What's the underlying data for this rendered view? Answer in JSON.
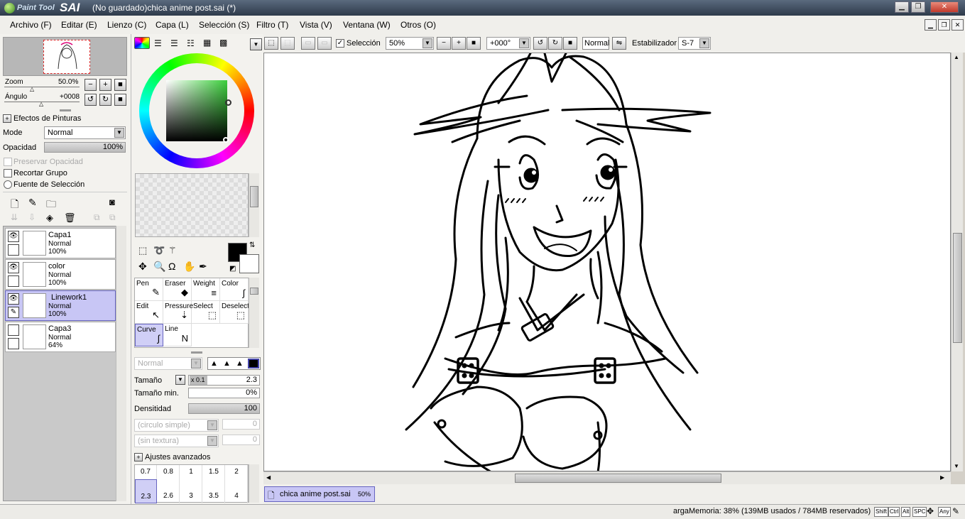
{
  "window": {
    "logo_small": "Paint Tool",
    "logo_big": "SAI",
    "title": "(No guardado)chica anime post.sai (*)"
  },
  "menu": [
    "Archivo (F)",
    "Editar (E)",
    "Lienzo (C)",
    "Capa (L)",
    "Selección (S)",
    "Filtro (T)",
    "Vista (V)",
    "Ventana (W)",
    "Otros (O)"
  ],
  "navigator": {
    "zoom_label": "Zoom",
    "zoom_value": "50.0%",
    "angle_label": "Ángulo",
    "angle_value": "+0008"
  },
  "effects": {
    "header": "Efectos de Pinturas",
    "mode_label": "Mode",
    "mode_value": "Normal",
    "opacity_label": "Opacidad",
    "opacity_value": "100%",
    "preserve_opacity": "Preservar Opacidad",
    "clip_group": "Recortar Grupo",
    "selection_source": "Fuente de Selección"
  },
  "layers": [
    {
      "name": "Capa1",
      "mode": "Normal",
      "opacity": "100%",
      "visible": true,
      "selected": false
    },
    {
      "name": "color",
      "mode": "Normal",
      "opacity": "100%",
      "visible": true,
      "selected": false
    },
    {
      "name": "Linework1",
      "mode": "Normal",
      "opacity": "100%",
      "visible": true,
      "selected": true
    },
    {
      "name": "Capa3",
      "mode": "Normal",
      "opacity": "64%",
      "visible": false,
      "selected": false
    }
  ],
  "colors": {
    "primary": "#000000",
    "secondary": "#ffffff",
    "accent_select": "#c8c6f5"
  },
  "tools": [
    {
      "name": "Pen",
      "icon": "pen-icon",
      "glyph": "✎"
    },
    {
      "name": "Eraser",
      "icon": "eraser-icon",
      "glyph": "◆"
    },
    {
      "name": "Weight",
      "icon": "weight-icon",
      "glyph": "≡"
    },
    {
      "name": "Color",
      "icon": "color-icon",
      "glyph": "∫"
    },
    {
      "name": "Edit",
      "icon": "edit-icon",
      "glyph": "↖"
    },
    {
      "name": "Pressure",
      "icon": "pressure-icon",
      "glyph": "⇣"
    },
    {
      "name": "Select",
      "icon": "select-icon",
      "glyph": "⬚"
    },
    {
      "name": "Deselect",
      "icon": "deselect-icon",
      "glyph": "⬚"
    },
    {
      "name": "Curve",
      "icon": "curve-icon",
      "glyph": "∫"
    },
    {
      "name": "Line",
      "icon": "line-icon",
      "glyph": "N"
    }
  ],
  "brush": {
    "blend_mode": "Normal",
    "size_label": "Tamaño",
    "size_mult": "x 0.1",
    "size_value": "2.3",
    "min_size_label": "Tamaño min.",
    "min_size_value": "0%",
    "density_label": "Densitidad",
    "density_value": "100",
    "shape": "(circulo simple)",
    "shape_value": "0",
    "texture": "(sin textura)",
    "texture_value": "0",
    "advanced": "Ajustes avanzados"
  },
  "brush_sizes_top": [
    "0.7",
    "0.8",
    "1",
    "1.5",
    "2"
  ],
  "brush_sizes_bottom": [
    "2.3",
    "2.6",
    "3",
    "3.5",
    "4"
  ],
  "toolbar": {
    "selection_label": "Selección",
    "zoom_value": "50%",
    "angle_value": "+000°",
    "blend_value": "Normal",
    "stabilizer_label": "Estabilizador",
    "stabilizer_value": "S-7"
  },
  "tab": {
    "name": "chica anime post.sai",
    "zoom": "50%"
  },
  "status": {
    "memory": "argaMemoria: 38% (139MB usados / 784MB reservados)",
    "keys": [
      "Shift",
      "Ctrl",
      "Alt",
      "SPC",
      "Any"
    ]
  }
}
